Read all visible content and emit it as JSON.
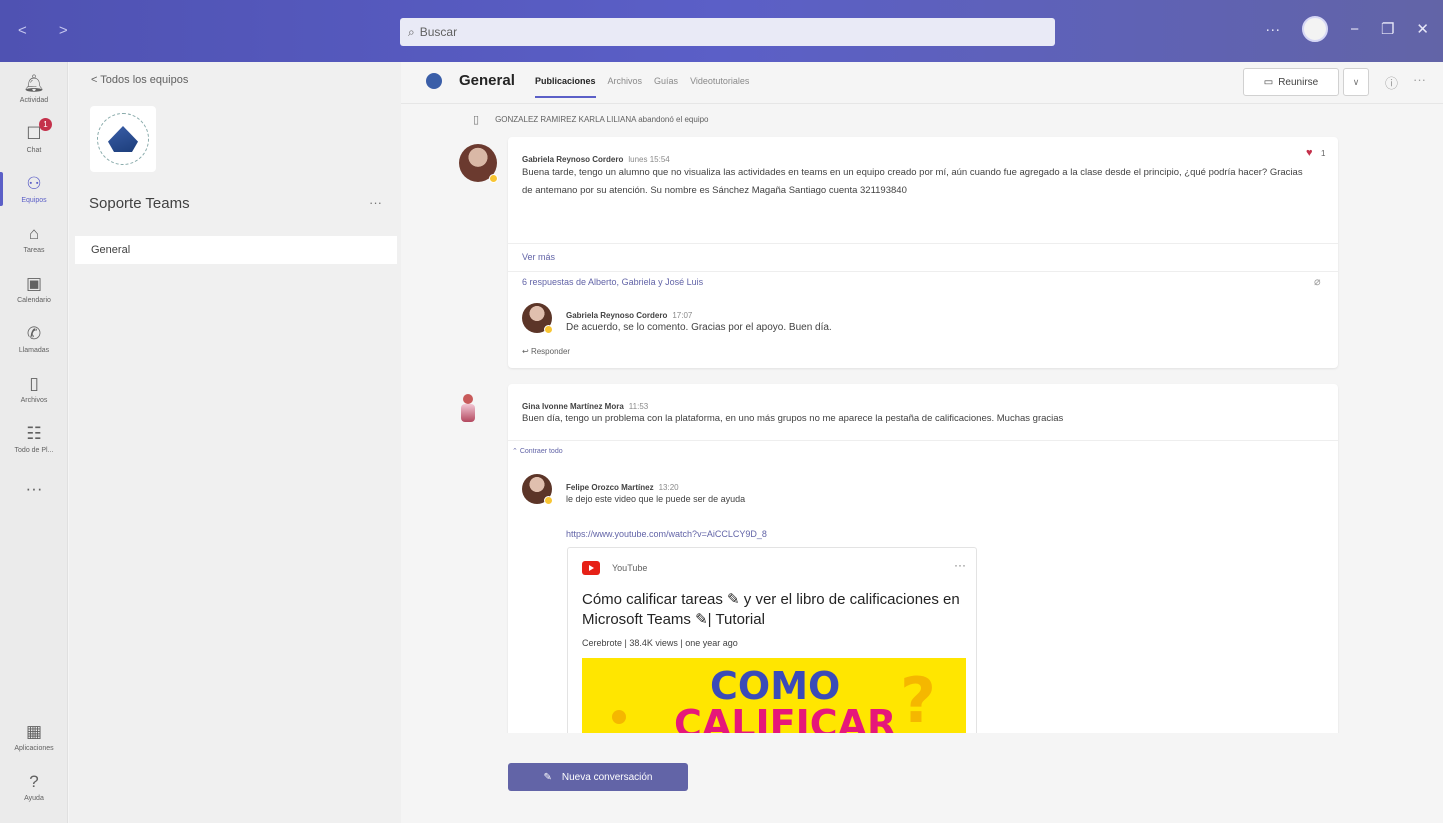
{
  "window": {
    "nav_arrows": "<   >",
    "search_placeholder": "Buscar",
    "controls": [
      "···",
      "−",
      "❐",
      "✕"
    ]
  },
  "rail": {
    "items": [
      {
        "label": "Actividad",
        "icon": "bell-icon",
        "glyph": "🔔"
      },
      {
        "label": "Chat",
        "icon": "chat-icon",
        "glyph": "💬",
        "badge": "1"
      },
      {
        "label": "Equipos",
        "icon": "teams-icon",
        "glyph": "👥",
        "active": true
      },
      {
        "label": "Tareas",
        "icon": "backpack-icon",
        "glyph": "🎒"
      },
      {
        "label": "Calendario",
        "icon": "calendar-icon",
        "glyph": "📅"
      },
      {
        "label": "Llamadas",
        "icon": "phone-icon",
        "glyph": "📞"
      },
      {
        "label": "Archivos",
        "icon": "file-icon",
        "glyph": "📄"
      },
      {
        "label": "Todo de Pl...",
        "icon": "planner-icon",
        "glyph": "📋"
      },
      {
        "label": "···",
        "icon": "more-icon",
        "glyph": ""
      }
    ],
    "bottom": [
      {
        "label": "Aplicaciones",
        "icon": "apps-icon",
        "glyph": "▦"
      },
      {
        "label": "Ayuda",
        "icon": "help-icon",
        "glyph": "?"
      }
    ]
  },
  "teams_panel": {
    "back_label": "<  Todos los equipos",
    "team_name": "Soporte Teams",
    "team_more": "···",
    "channel": "General"
  },
  "header": {
    "channel_title": "General",
    "tabs": [
      "Publicaciones",
      "Archivos",
      "Guías",
      "Videotutoriales"
    ],
    "meet_label": "Reunirse",
    "meet_caret": "∨",
    "info": "ⓘ",
    "more": "···"
  },
  "feed": {
    "system_message": "GONZALEZ RAMIREZ KARLA LILIANA abandonó el equipo",
    "post1": {
      "author": "Gabriela Reynoso Cordero",
      "time": "lunes 15:54",
      "text": "Buena tarde, tengo un alumno que no visualiza las actividades en teams en un equipo creado por mí, aún cuando fue agregado a la clase desde el principio, ¿qué podría hacer? Gracias de antemano por su atención. Su nombre es Sánchez Magaña Santiago cuenta 321193840",
      "see_more": "Ver más",
      "replies_summary": "6 respuestas de Alberto, Gabriela y José Luis",
      "reaction_count": "1",
      "reply": {
        "author": "Gabriela Reynoso Cordero",
        "time": "17:07",
        "text": "De acuerdo, se lo comento. Gracias por el apoyo. Buen día."
      },
      "reply_action": "Responder"
    },
    "post2": {
      "author": "Gina Ivonne Martínez Mora",
      "time": "11:53",
      "text": "Buen día, tengo un problema con la plataforma, en uno más grupos no me aparece la pestaña de calificaciones. Muchas gracias",
      "collapse": "Contraer todo",
      "reply": {
        "author": "Felipe Orozco Martínez",
        "time": "13:20",
        "text": "le dejo este video que le puede ser de ayuda",
        "link": "https://www.youtube.com/watch?v=AiCCLCY9D_8"
      },
      "youtube": {
        "source": "YouTube",
        "title": "Cómo calificar tareas ✎ y ver el libro de calificaciones en Microsoft Teams ✎| Tutorial",
        "meta": "Cerebrote | 38.4K views | one year ago",
        "thumb_line1": "COMO",
        "thumb_line2": "CALIFICAR",
        "thumb_mark": "?"
      }
    }
  },
  "compose": {
    "new_conversation": "Nueva conversación"
  },
  "colors": {
    "brand": "#5b5fc7",
    "reaction": "#c4314b",
    "presence_away": "#f8c533"
  }
}
